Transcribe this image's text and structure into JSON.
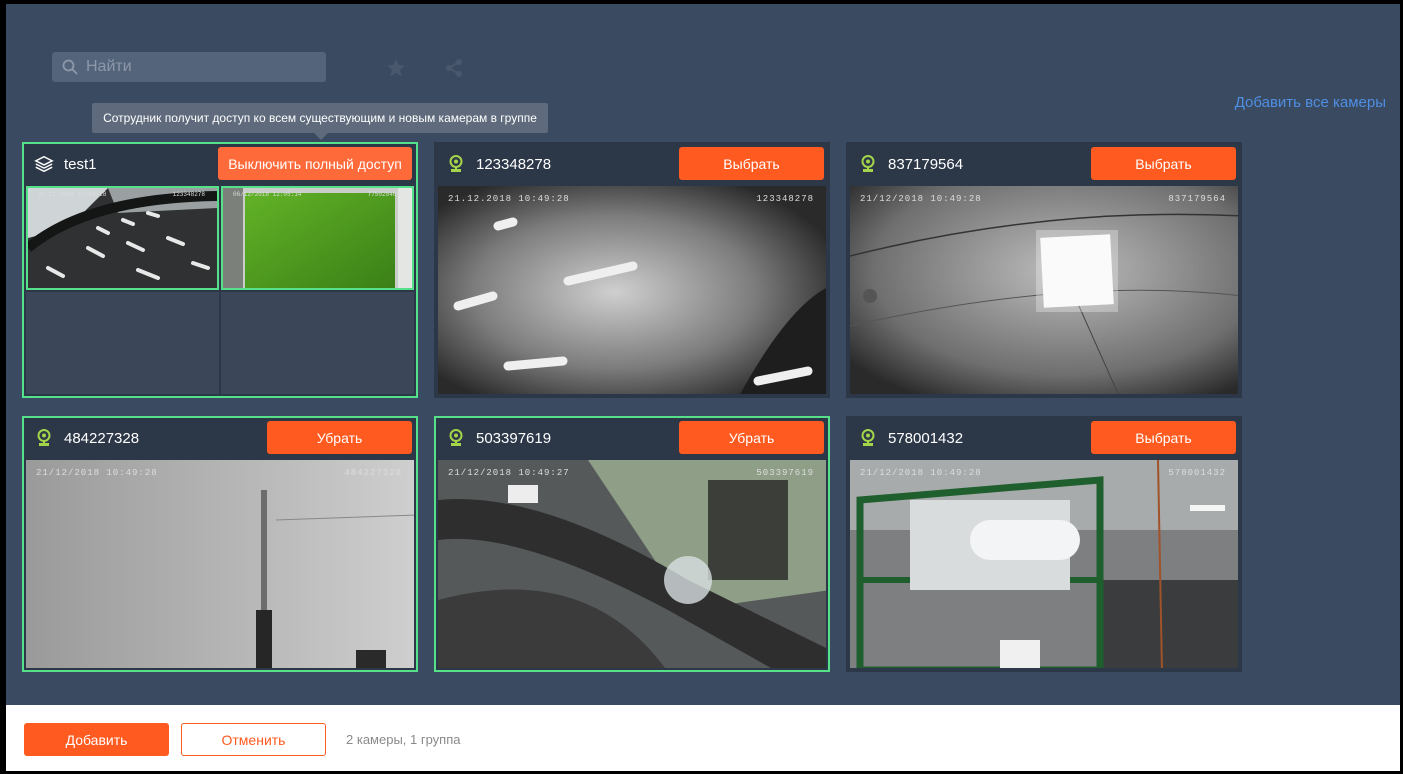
{
  "search": {
    "placeholder": "Найти"
  },
  "toolbar": {
    "add_all_label": "Добавить все камеры"
  },
  "tooltip": {
    "text": "Сотрудник получит доступ ко всем существующим и новым камерам в группе"
  },
  "group": {
    "name": "test1",
    "button_label": "Выключить полный доступ",
    "thumbs": [
      {
        "date": "21.12.2018 10:49:28",
        "id": "123348278"
      },
      {
        "date": "06/12/2018 12:05:14",
        "id": "775028469"
      }
    ]
  },
  "cameras": [
    {
      "id": "123348278",
      "button_label": "Выбрать",
      "osd_date": "21.12.2018 10:49:28",
      "osd_id": "123348278"
    },
    {
      "id": "837179564",
      "button_label": "Выбрать",
      "osd_date": "21/12/2018 10:49:28",
      "osd_id": "837179564"
    },
    {
      "id": "484227328",
      "button_label": "Убрать",
      "osd_date": "21/12/2018 10:49:28",
      "osd_id": "484227328"
    },
    {
      "id": "503397619",
      "button_label": "Убрать",
      "osd_date": "21/12/2018 10:49:27",
      "osd_id": "503397619"
    },
    {
      "id": "578001432",
      "button_label": "Выбрать",
      "osd_date": "21/12/2018 10:49:28",
      "osd_id": "578001432"
    }
  ],
  "footer": {
    "add_label": "Добавить",
    "cancel_label": "Отменить",
    "summary": "2 камеры, 1 группа"
  },
  "colors": {
    "accent": "#ff5a1f",
    "selected_border": "#57e08a",
    "link": "#4f8fe3",
    "camera_icon": "#a4d44a"
  }
}
